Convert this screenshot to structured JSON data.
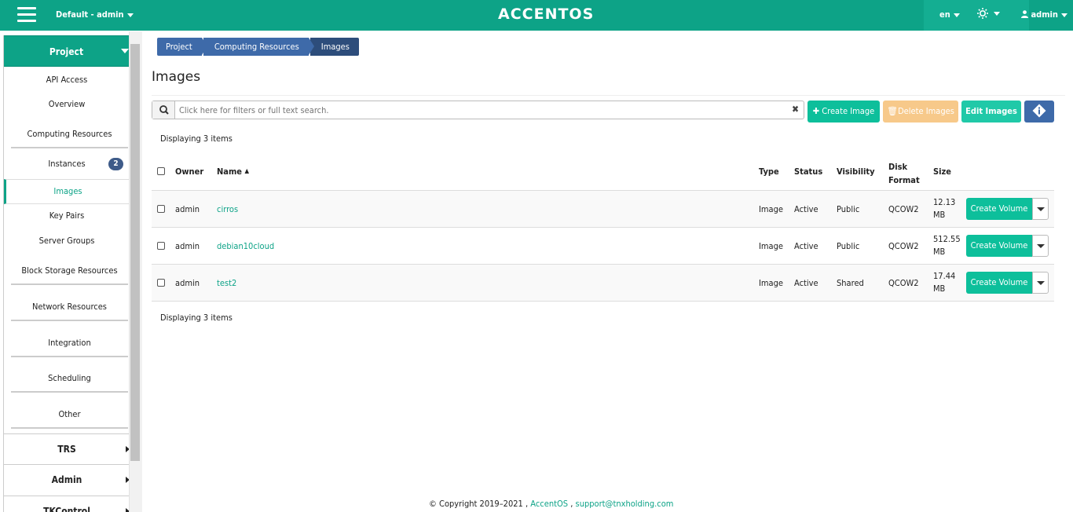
{
  "topbar": {
    "project_selector": "Default - admin",
    "logo": "ACCENTOS",
    "language": "en",
    "user": "admin"
  },
  "sidebar": {
    "project": "Project",
    "items": [
      {
        "label": "API Access"
      },
      {
        "label": "Overview"
      },
      {
        "label": "Computing Resources"
      },
      {
        "label": "Instances",
        "badge": "2"
      },
      {
        "label": "Images"
      },
      {
        "label": "Key Pairs"
      },
      {
        "label": "Server Groups"
      },
      {
        "label": "Block Storage Resources"
      },
      {
        "label": "Network Resources"
      },
      {
        "label": "Integration"
      },
      {
        "label": "Scheduling"
      },
      {
        "label": "Other"
      }
    ],
    "sections": [
      "TRS",
      "Admin",
      "TKControl"
    ]
  },
  "breadcrumb": [
    "Project",
    "Computing Resources",
    "Images"
  ],
  "page_title": "Images",
  "search": {
    "placeholder": "Click here for filters or full text search."
  },
  "actions": {
    "create": "Create Image",
    "delete": "Delete Images",
    "edit": "Edit Images"
  },
  "display_count": "Displaying 3 items",
  "table": {
    "headers": {
      "owner": "Owner",
      "name": "Name",
      "type": "Type",
      "status": "Status",
      "visibility": "Visibility",
      "disk_format_1": "Disk",
      "disk_format_2": "Format",
      "size": "Size"
    },
    "rows": [
      {
        "owner": "admin",
        "name": "cirros",
        "type": "Image",
        "status": "Active",
        "visibility": "Public",
        "format": "QCOW2",
        "size_num": "12.13",
        "size_unit": "MB",
        "action": "Create Volume"
      },
      {
        "owner": "admin",
        "name": "debian10cloud",
        "type": "Image",
        "status": "Active",
        "visibility": "Public",
        "format": "QCOW2",
        "size_num": "512.55",
        "size_unit": "MB",
        "action": "Create Volume"
      },
      {
        "owner": "admin",
        "name": "test2",
        "type": "Image",
        "status": "Active",
        "visibility": "Shared",
        "format": "QCOW2",
        "size_num": "17.44",
        "size_unit": "MB",
        "action": "Create Volume"
      }
    ]
  },
  "footer": {
    "copyright": "© Copyright 2019–2021 ,",
    "brand": "AccentOS",
    "sep": ",",
    "email": "support@tnxholding.com"
  },
  "colors": {
    "accent": "#0da387",
    "primary": "#3e6aa9",
    "warning": "#f7c98a"
  }
}
